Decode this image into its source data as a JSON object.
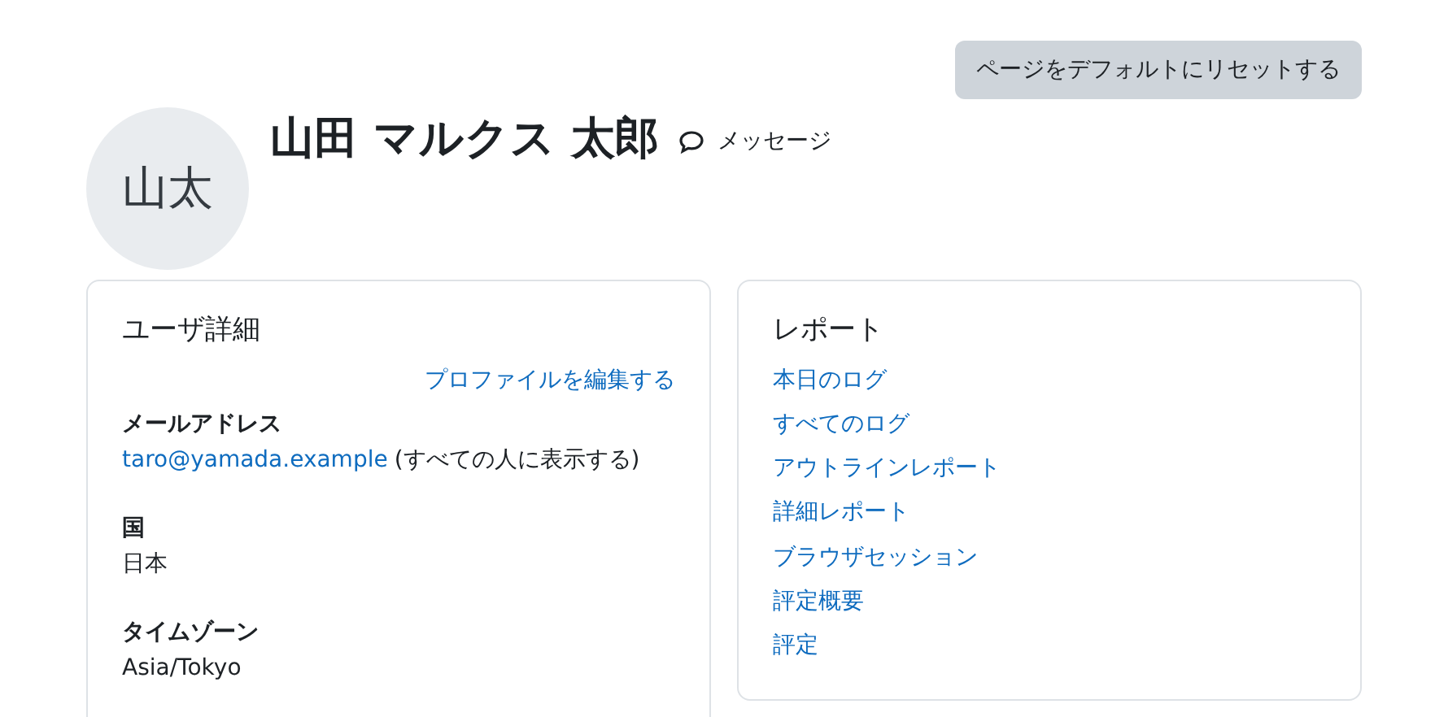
{
  "reset_button": "ページをデフォルトにリセットする",
  "profile": {
    "initials": "山太",
    "name": "山田 マルクス 太郎",
    "message_link": "メッセージ"
  },
  "user_details": {
    "title": "ユーザ詳細",
    "edit_link": "プロファイルを編集する",
    "fields": [
      {
        "kind": "email",
        "label": "メールアドレス",
        "value": "taro@yamada.example",
        "note": "(すべての人に表示する)"
      },
      {
        "kind": "text",
        "label": "国",
        "value": "日本"
      },
      {
        "kind": "text",
        "label": "タイムゾーン",
        "value": "Asia/Tokyo"
      }
    ]
  },
  "reports": {
    "title": "レポート",
    "links": [
      "本日のログ",
      "すべてのログ",
      "アウトラインレポート",
      "詳細レポート",
      "ブラウザセッション",
      "評定概要",
      "評定"
    ]
  }
}
